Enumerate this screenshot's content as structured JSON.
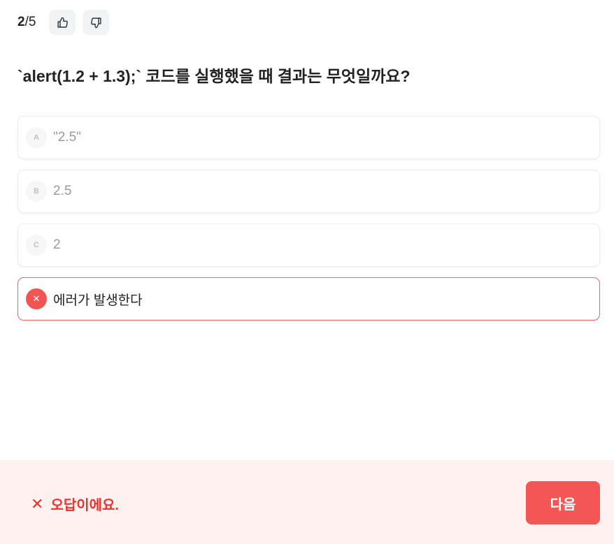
{
  "progress": {
    "current": "2",
    "separator": "/",
    "total": "5"
  },
  "feedback": {
    "like_icon": "thumbs-up-icon",
    "dislike_icon": "thumbs-down-icon"
  },
  "question": {
    "text": "`alert(1.2 + 1.3);` 코드를 실행했을 때 결과는 무엇일까요?"
  },
  "options": [
    {
      "letter": "A",
      "text": "\"2.5\"",
      "state": "default"
    },
    {
      "letter": "B",
      "text": "2.5",
      "state": "default"
    },
    {
      "letter": "C",
      "text": "2",
      "state": "default"
    },
    {
      "letter": "✕",
      "text": "에러가 발생한다",
      "state": "wrong-selected"
    }
  ],
  "result": {
    "icon": "✕",
    "message": "오답이에요."
  },
  "next_button": {
    "label": "다음"
  },
  "colors": {
    "accent_red": "#f45656",
    "result_text": "#e5352f",
    "footer_bg": "#fff1f0"
  }
}
